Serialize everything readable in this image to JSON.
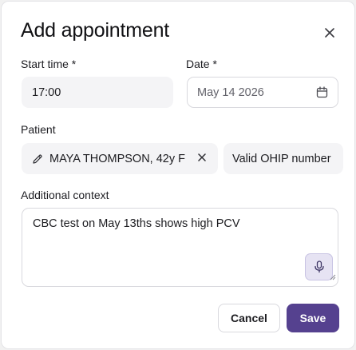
{
  "dialog": {
    "title": "Add appointment"
  },
  "form": {
    "start_time": {
      "label": "Start time *",
      "value": "17:00"
    },
    "date": {
      "label": "Date *",
      "value": "May 14 2026"
    },
    "patient": {
      "label": "Patient",
      "selected": "MAYA THOMPSON, 42y F",
      "ohip_status": "Valid OHIP number"
    },
    "context": {
      "label": "Additional context",
      "value": "CBC test on May 13ths shows high PCV"
    }
  },
  "actions": {
    "cancel_label": "Cancel",
    "save_label": "Save"
  },
  "icons": {
    "close": "close-icon",
    "calendar": "calendar-icon",
    "edit": "pencil-icon",
    "remove": "x-icon",
    "mic": "microphone-icon"
  },
  "colors": {
    "primary": "#55418f",
    "mic_bg": "#e6e3f3",
    "field_bg": "#f4f4f6"
  }
}
